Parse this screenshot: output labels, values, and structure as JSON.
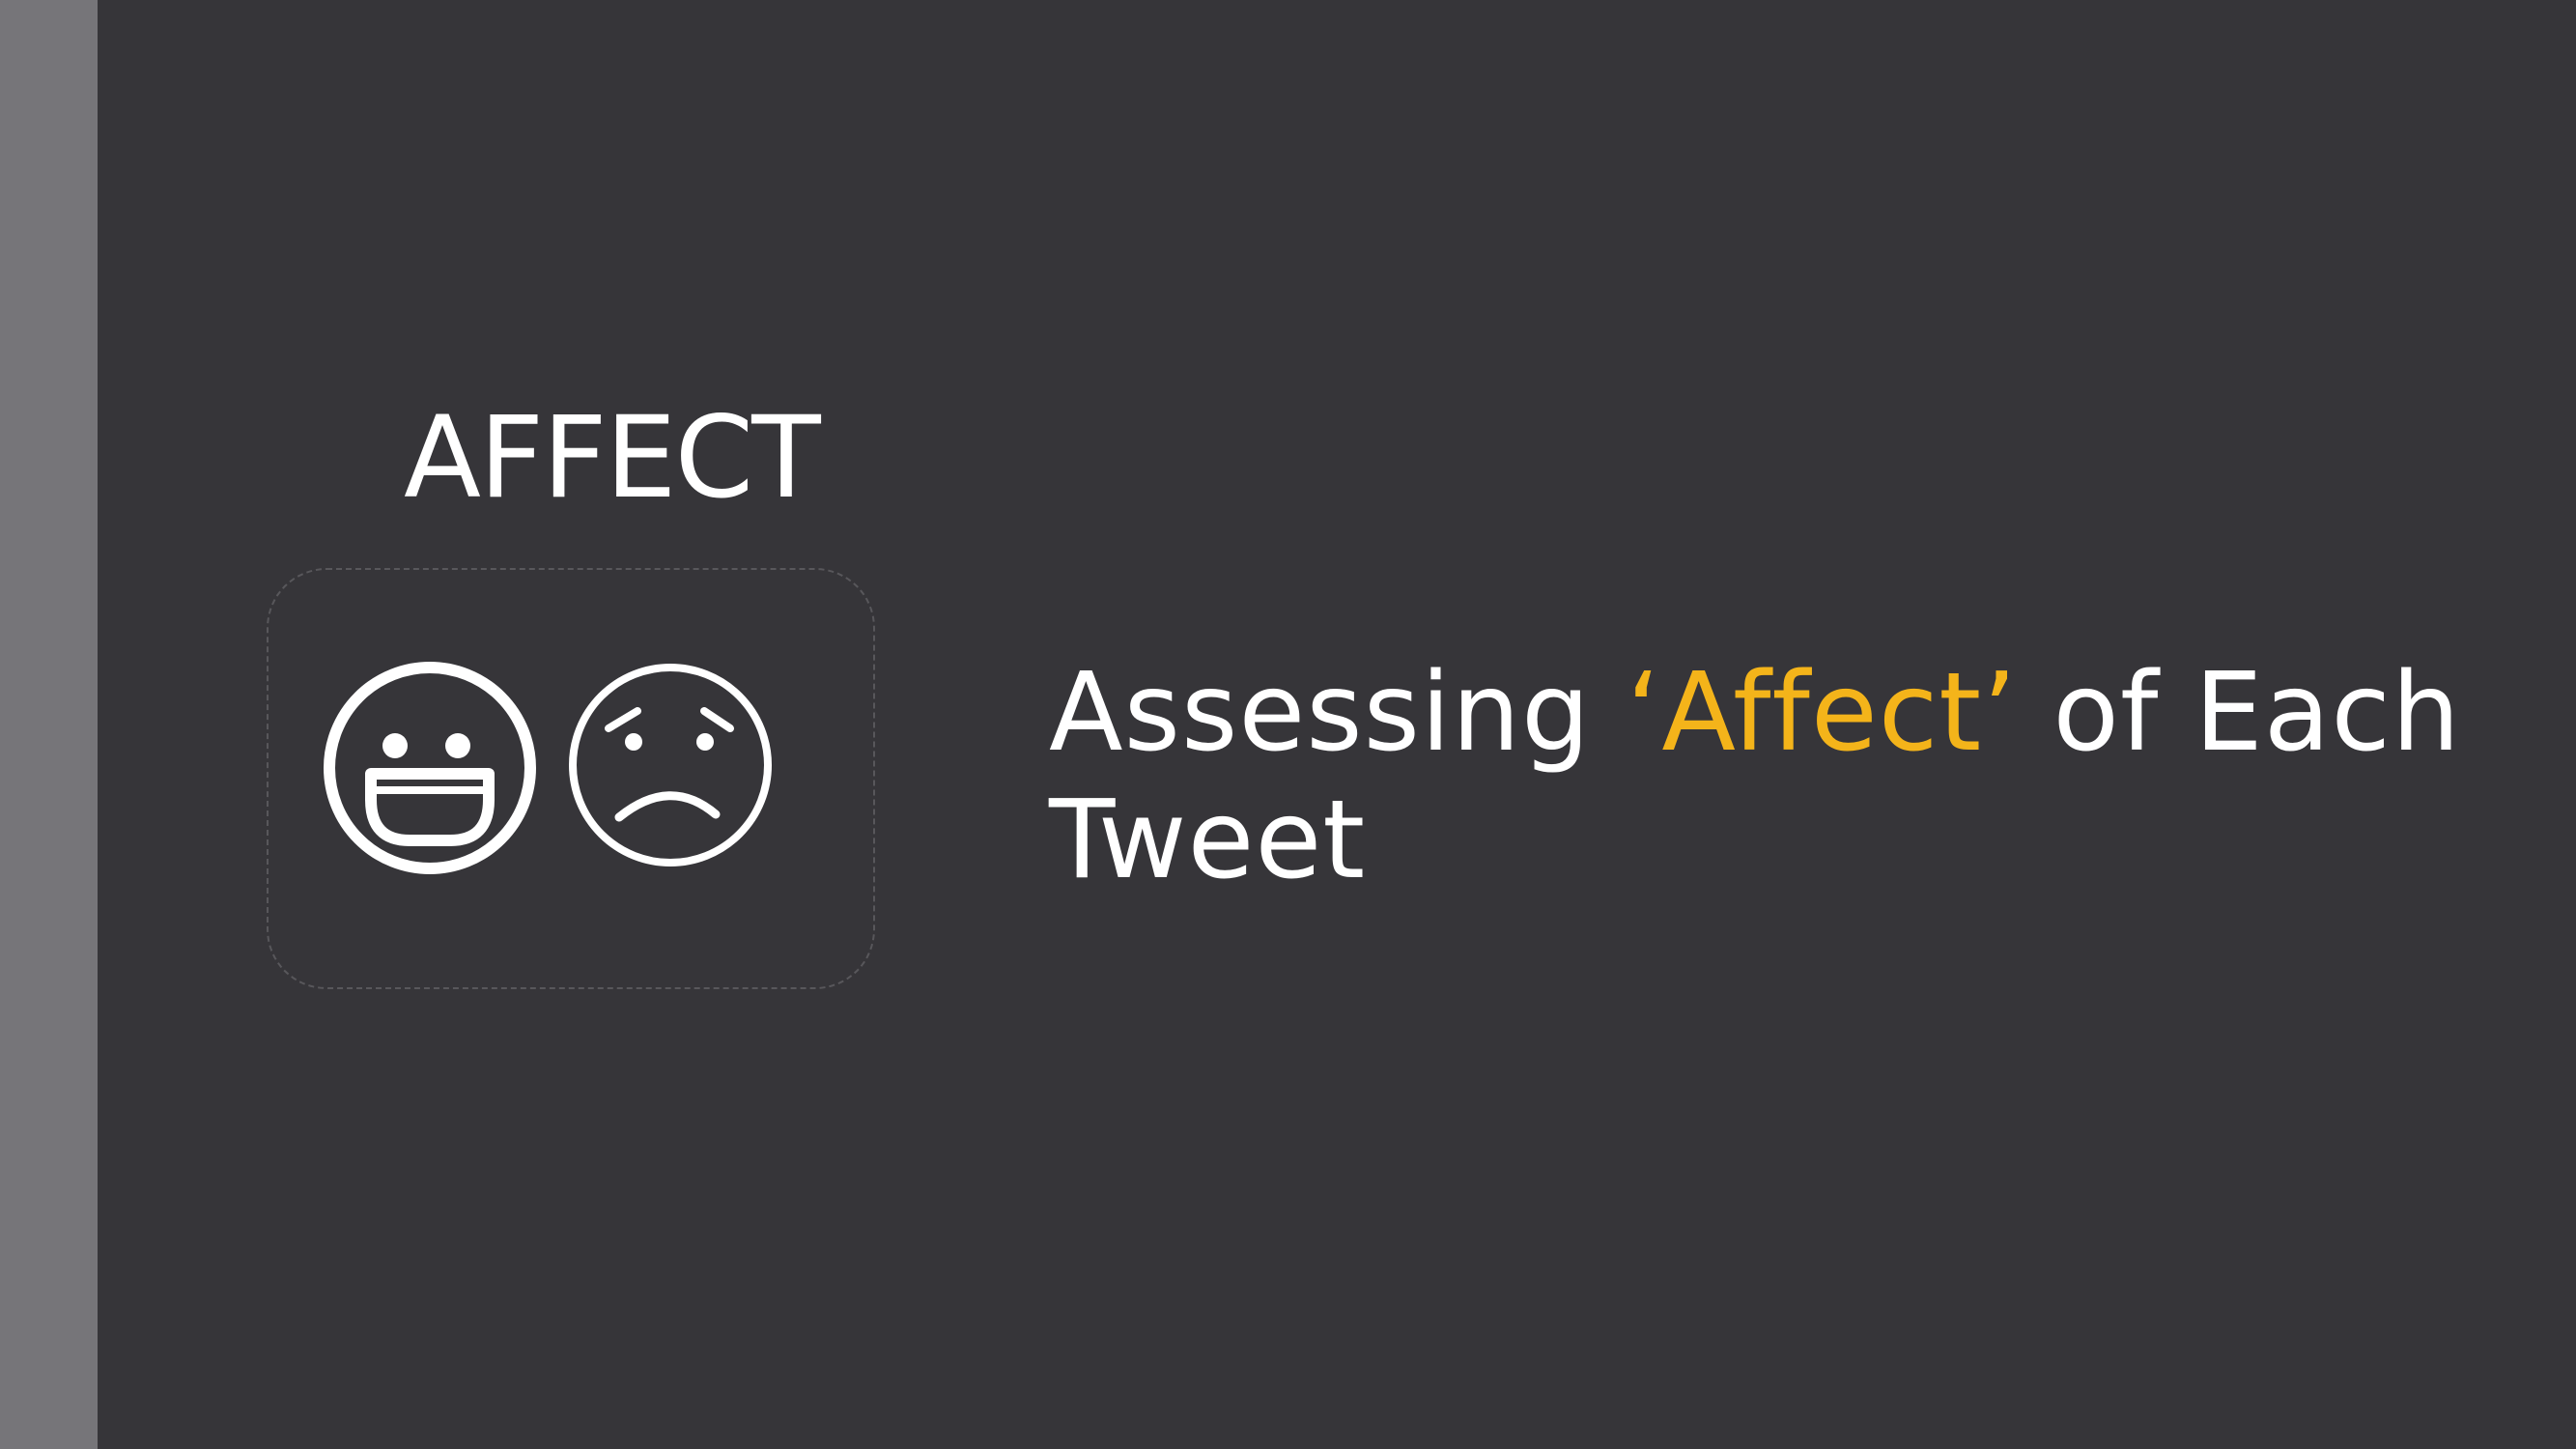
{
  "sidebar": {
    "color": "#767579"
  },
  "theme": {
    "background": "#363539",
    "text": "#ffffff",
    "accent": "#f4b41a",
    "box_border": "#58575b"
  },
  "icon_panel": {
    "label": "AFFECT",
    "icons": [
      "happy-face-icon",
      "sad-face-icon"
    ]
  },
  "title": {
    "prefix": "Assessing ",
    "highlight": "‘Affect’",
    "suffix": " of Each Tweet"
  }
}
